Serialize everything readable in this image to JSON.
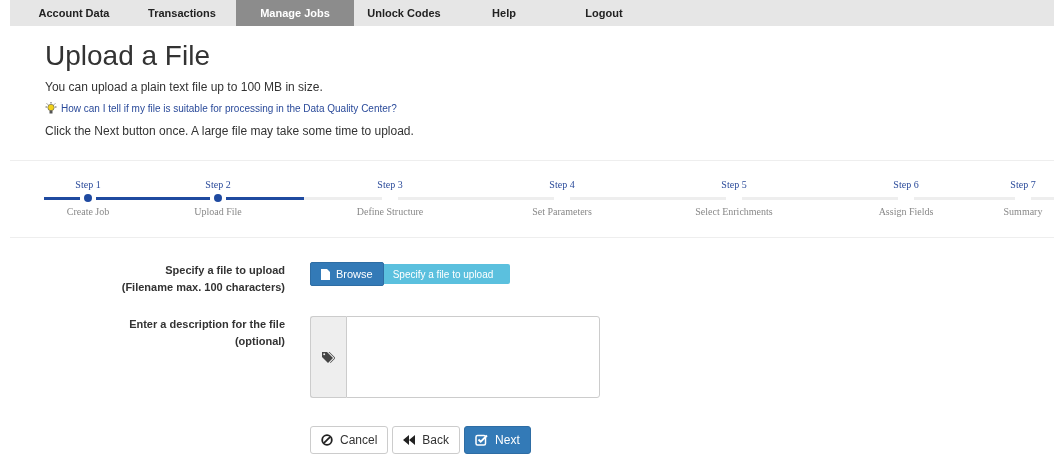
{
  "nav": [
    {
      "label": "Account Data",
      "selected": false
    },
    {
      "label": "Transactions",
      "selected": false
    },
    {
      "label": "Manage Jobs",
      "selected": true
    },
    {
      "label": "Unlock Codes",
      "selected": false
    },
    {
      "label": "Help",
      "selected": false
    },
    {
      "label": "Logout",
      "selected": false
    }
  ],
  "title": "Upload a File",
  "intro": "You can upload a plain text file up to 100 MB in size.",
  "help_link": "How can I tell if my file is suitable for processing in the Data Quality Center?",
  "note": "Click the Next button once. A large file may take some time to upload.",
  "steps": [
    {
      "step": "Step 1",
      "label": "Create Job",
      "completed": true
    },
    {
      "step": "Step 2",
      "label": "Upload File",
      "completed": true
    },
    {
      "step": "Step 3",
      "label": "Define Structure",
      "completed": false
    },
    {
      "step": "Step 4",
      "label": "Set Parameters",
      "completed": false
    },
    {
      "step": "Step 5",
      "label": "Select Enrichments",
      "completed": false
    },
    {
      "step": "Step 6",
      "label": "Assign Fields",
      "completed": false
    },
    {
      "step": "Step 7",
      "label": "Summary",
      "completed": false
    }
  ],
  "file_field": {
    "label": "Specify a file to upload",
    "sublabel": "(Filename max. 100 characters)",
    "browse": "Browse",
    "placeholder": "Specify a file to upload"
  },
  "description_field": {
    "label": "Enter a description for the file",
    "sublabel": "(optional)"
  },
  "buttons": [
    {
      "kind": "cancel",
      "label": "Cancel"
    },
    {
      "kind": "back",
      "label": "Back"
    },
    {
      "kind": "next",
      "label": "Next"
    }
  ]
}
